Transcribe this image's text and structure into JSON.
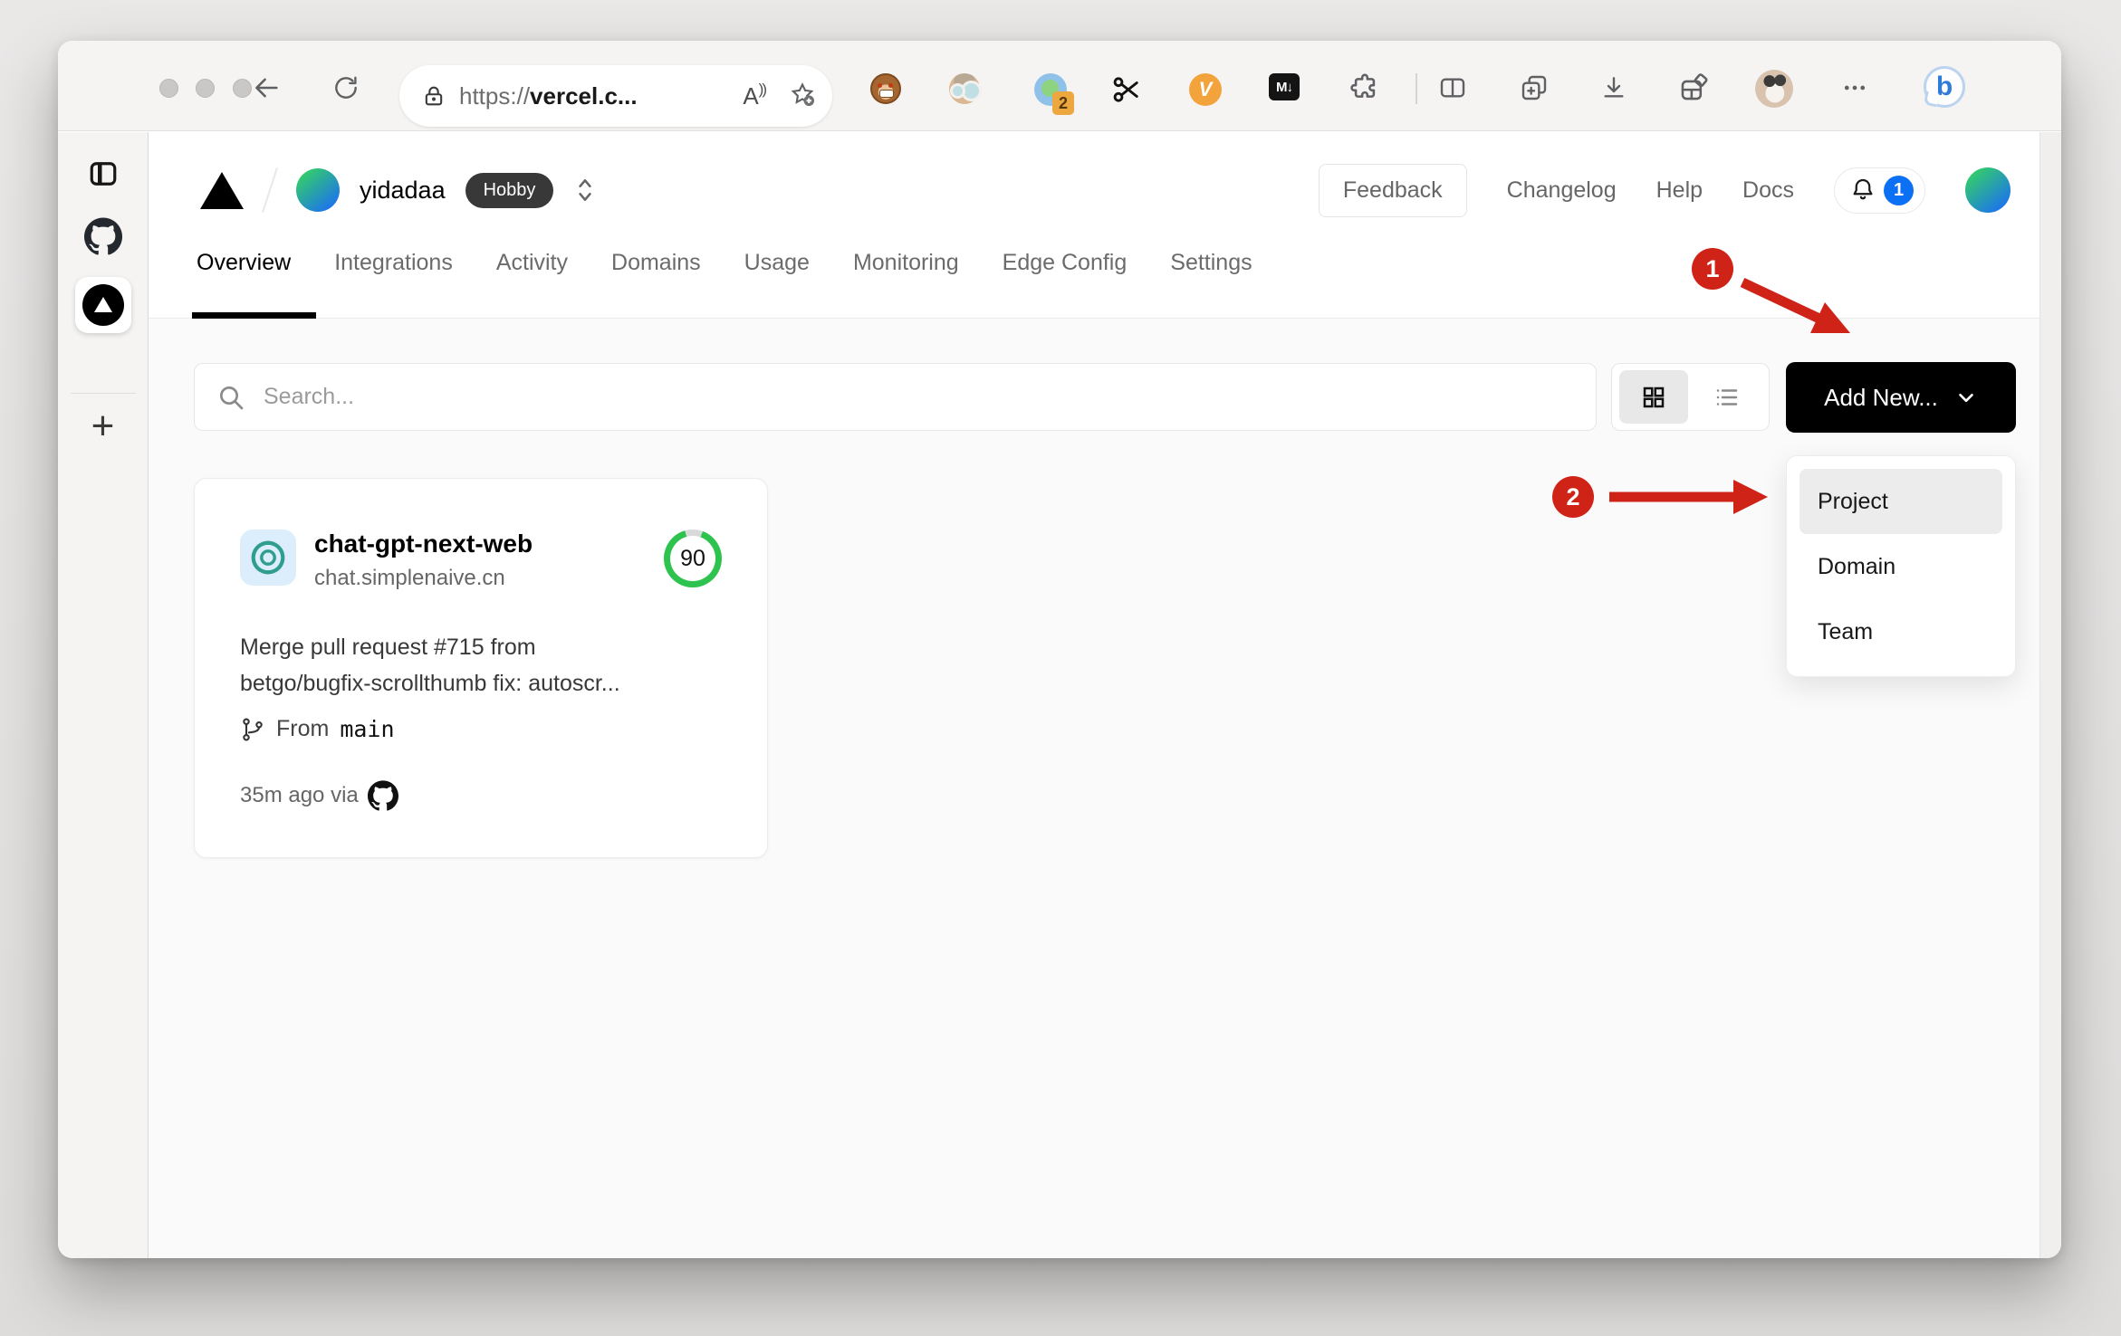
{
  "browser": {
    "url": {
      "prefix": "https://",
      "host": "vercel.c..."
    },
    "read_aloud_label": "A",
    "read_aloud_arcs": "))",
    "extensions": {
      "proxy_badge": "2",
      "v_label": "V",
      "md_label": "M↓"
    },
    "bing_label": "b"
  },
  "edge_sidebar": {
    "new_tab_label": "+"
  },
  "vercel": {
    "team": {
      "name": "yidadaa",
      "plan": "Hobby"
    },
    "header_links": {
      "feedback": "Feedback",
      "changelog": "Changelog",
      "help": "Help",
      "docs": "Docs"
    },
    "notifications": {
      "count": "1"
    },
    "tabs": [
      {
        "label": "Overview"
      },
      {
        "label": "Integrations"
      },
      {
        "label": "Activity"
      },
      {
        "label": "Domains"
      },
      {
        "label": "Usage"
      },
      {
        "label": "Monitoring"
      },
      {
        "label": "Edge Config"
      },
      {
        "label": "Settings"
      }
    ],
    "toolbar": {
      "search_placeholder": "Search...",
      "add_new_label": "Add New..."
    },
    "dropdown": {
      "items": [
        {
          "label": "Project"
        },
        {
          "label": "Domain"
        },
        {
          "label": "Team"
        }
      ]
    },
    "project_card": {
      "name": "chat-gpt-next-web",
      "domain": "chat.simplenaive.cn",
      "score": "90",
      "commit_line1": "Merge pull request #715 from",
      "commit_line2": "betgo/bugfix-scrollthumb fix: autoscr...",
      "branch_label": "From",
      "branch_name": "main",
      "meta": "35m ago via"
    }
  },
  "annotations": {
    "step1": "1",
    "step2": "2"
  },
  "colors": {
    "annotation_red": "#cf2318",
    "score_green": "#2ec24e",
    "badge_blue": "#0b70f3"
  }
}
